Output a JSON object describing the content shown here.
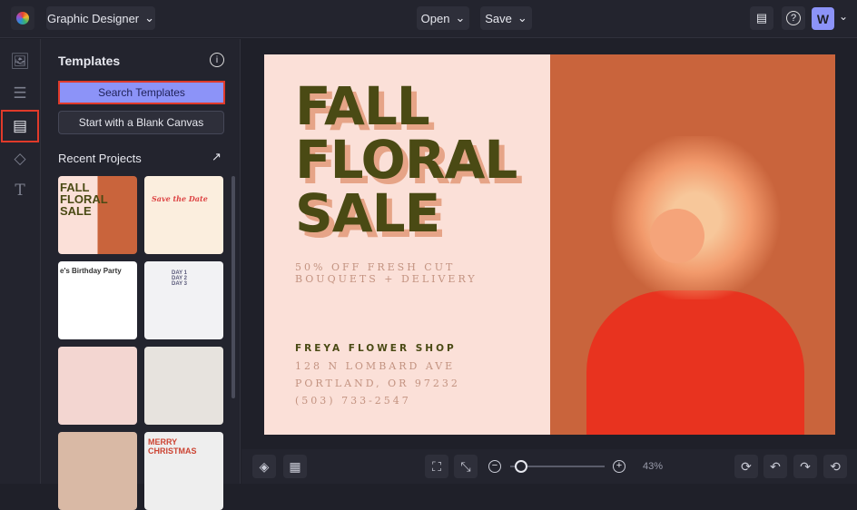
{
  "topbar": {
    "mode": "Graphic Designer",
    "open": "Open",
    "save": "Save",
    "avatar": "W"
  },
  "panel": {
    "title": "Templates",
    "search": "Search Templates",
    "blank": "Start with a Blank Canvas",
    "recent": "Recent Projects",
    "thumbs": [
      "FALL FLORAL SALE",
      "Save the Date",
      "e's Birthday Party",
      "DAY 1 DAY 2 DAY 3",
      "",
      "",
      "",
      "MERRY CHRISTMAS"
    ]
  },
  "design": {
    "line1": "FALL",
    "line2": "FLORAL",
    "line3": "SALE",
    "offer1": "50% OFF FRESH CUT",
    "offer2": "BOUQUETS + DELIVERY",
    "shop": "FREYA FLOWER SHOP",
    "addr1": "128 N LOMBARD AVE",
    "addr2": "PORTLAND, OR 97232",
    "phone": "(503) 733-2547"
  },
  "zoom": {
    "label": "43%",
    "value": 0.05
  },
  "colors": {
    "accent": "#8c93f8",
    "highlight": "#e03a2a"
  }
}
